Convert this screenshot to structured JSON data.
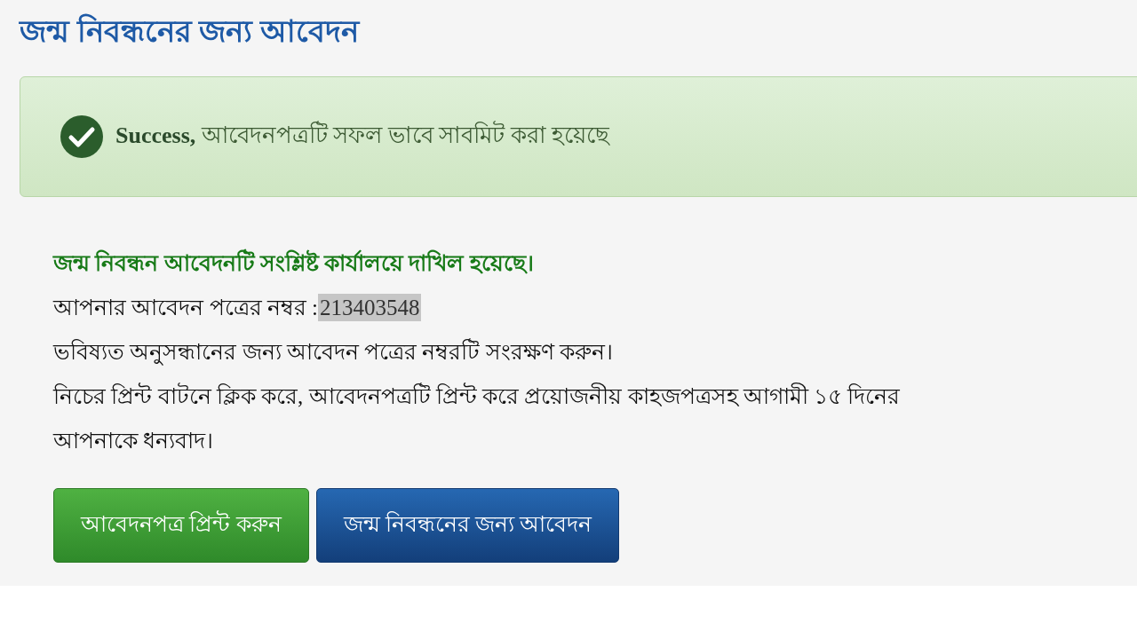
{
  "title": "জন্ম নিবন্ধনের জন্য আবেদন",
  "alert": {
    "kind": "success",
    "label": "Success,",
    "message": "আবেদনপত্রটি সফল ভাবে সাবমিট করা হয়েছে"
  },
  "confirmation": "জন্ম নিবন্ধন আবেদনটি সংশ্লিষ্ট কার্যালয়ে দাখিল হয়েছে।",
  "application_number": {
    "label": "আপনার আবেদন পত্রের নম্বর :",
    "value": "213403548",
    "highlighted": true
  },
  "instructions": [
    "ভবিষ্যত অনুসন্ধানের জন্য আবেদন পত্রের নম্বরটি সংরক্ষণ করুন।",
    "নিচের প্রিন্ট বাটনে ক্লিক করে, আবেদনপত্রটি প্রিন্ট করে প্রয়োজনীয় কাহজপত্রসহ আগামী ১৫ দিনের",
    "আপনাকে ধন্যবাদ।"
  ],
  "buttons": [
    {
      "label": "আবেদনপত্র প্রিন্ট করুন",
      "kind": "print"
    },
    {
      "label": "জন্ম নিবন্ধনের জন্য আবেদন",
      "kind": "primary"
    }
  ]
}
